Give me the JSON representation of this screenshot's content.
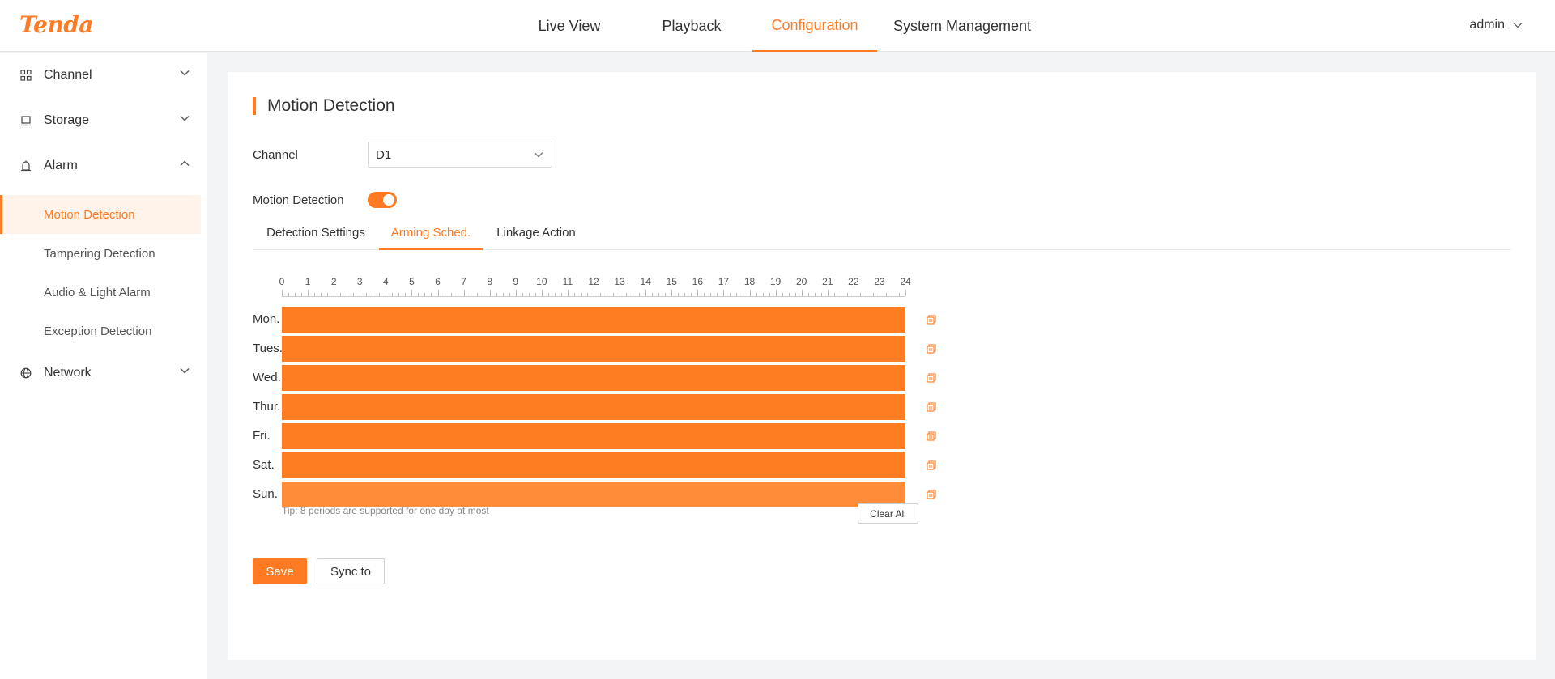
{
  "brand": {
    "logo_text": "Tenda",
    "accent": "#ff7a22"
  },
  "nav": {
    "items": [
      {
        "label": "Live View"
      },
      {
        "label": "Playback"
      },
      {
        "label": "Configuration",
        "active": true
      },
      {
        "label": "System Management"
      }
    ]
  },
  "user": {
    "name": "admin",
    "icon": "chevron-down-icon"
  },
  "sidebar": {
    "groups": [
      {
        "label": "Channel",
        "icon": "grid-icon",
        "expanded": false
      },
      {
        "label": "Storage",
        "icon": "hdd-icon",
        "expanded": false
      },
      {
        "label": "Alarm",
        "icon": "alarm-icon",
        "expanded": true,
        "items": [
          {
            "label": "Motion Detection",
            "active": true
          },
          {
            "label": "Tampering Detection"
          },
          {
            "label": "Audio & Light Alarm"
          },
          {
            "label": "Exception Detection"
          }
        ]
      },
      {
        "label": "Network",
        "icon": "globe-icon",
        "expanded": false
      }
    ]
  },
  "page": {
    "title": "Motion Detection",
    "channel": {
      "label": "Channel",
      "value": "D1"
    },
    "motion_detection": {
      "label": "Motion Detection",
      "enabled": true
    },
    "tabs": [
      {
        "label": "Detection Settings"
      },
      {
        "label": "Arming Sched.",
        "active": true
      },
      {
        "label": "Linkage Action"
      }
    ]
  },
  "schedule": {
    "hours": [
      "0",
      "1",
      "2",
      "3",
      "4",
      "5",
      "6",
      "7",
      "8",
      "9",
      "10",
      "11",
      "12",
      "13",
      "14",
      "15",
      "16",
      "17",
      "18",
      "19",
      "20",
      "21",
      "22",
      "23",
      "24"
    ],
    "days": [
      {
        "label": "Mon.",
        "start": 0,
        "end": 24
      },
      {
        "label": "Tues.",
        "start": 0,
        "end": 24
      },
      {
        "label": "Wed.",
        "start": 0,
        "end": 24
      },
      {
        "label": "Thur.",
        "start": 0,
        "end": 24
      },
      {
        "label": "Fri.",
        "start": 0,
        "end": 24
      },
      {
        "label": "Sat.",
        "start": 0,
        "end": 24
      },
      {
        "label": "Sun.",
        "start": 0,
        "end": 24,
        "highlight": true
      }
    ],
    "tip": "Tip: 8 periods are supported for one day at most",
    "clear_label": "Clear All",
    "fill_color": "#ff7d21",
    "copy_icon": "copy-icon"
  },
  "actions": {
    "save_label": "Save",
    "sync_label": "Sync to"
  }
}
